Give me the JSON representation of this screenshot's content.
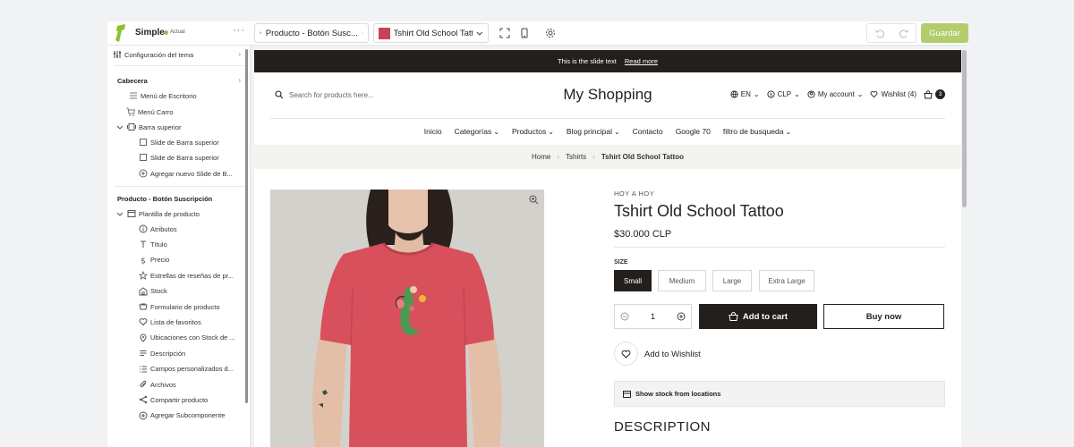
{
  "topbar": {
    "brand": "Simple",
    "status": "Actual",
    "more": "···",
    "template_select": "Producto - Botón Susc...",
    "product_select": "Tshirt Old School Tattc",
    "save_label": "Guardar"
  },
  "sidebar": {
    "theme_settings": "Configuración del tema",
    "header_section": "Cabecera",
    "desktop_menu": "Menú de Escritorio",
    "cart_menu": "Menú Carro",
    "top_bar": "Barra superior",
    "slide_1": "Slide de Barra superior",
    "slide_2": "Slide de Barra superior",
    "add_slide": "Agregar nuevo Slide de B...",
    "product_section": "Producto - Botón Suscripción",
    "product_template": "Plantilla de producto",
    "items": [
      {
        "label": "Atributos",
        "icon": "info-icon"
      },
      {
        "label": "Título",
        "icon": "text-icon"
      },
      {
        "label": "Precio",
        "icon": "dollar-icon"
      },
      {
        "label": "Estrellas de reseñas de pr...",
        "icon": "star-review-icon"
      },
      {
        "label": "Stock",
        "icon": "warehouse-icon"
      },
      {
        "label": "Formulario de producto",
        "icon": "cart-form-icon"
      },
      {
        "label": "Lista de favoritos",
        "icon": "heart-icon"
      },
      {
        "label": "Ubicaciones con Stock de ...",
        "icon": "location-icon"
      },
      {
        "label": "Descripción",
        "icon": "description-icon"
      },
      {
        "label": "Campos personalizados d...",
        "icon": "list-icon"
      },
      {
        "label": "Archivos",
        "icon": "attachment-icon"
      },
      {
        "label": "Compartir producto",
        "icon": "share-icon"
      },
      {
        "label": "Agregar Subcomponente",
        "icon": "plus-circle-icon"
      }
    ]
  },
  "preview": {
    "announcement": "This is the slide text",
    "announcement_link": "Read more",
    "search_placeholder": "Search for products here...",
    "shop_title": "My Shopping",
    "lang": "EN",
    "currency": "CLP",
    "account": "My account",
    "wishlist": "Wishlist (4)",
    "cart_count": "3",
    "nav": [
      "Inicio",
      "Categorías",
      "Productos",
      "Blog principal",
      "Contacto",
      "Google 70",
      "filtro de busqueda"
    ],
    "breadcrumb": {
      "home": "Home",
      "category": "Tshirts",
      "current": "Tshirt Old School Tattoo"
    },
    "product": {
      "vendor": "HOY A HOY",
      "title": "Tshirt Old School Tattoo",
      "price": "$30.000 CLP",
      "size_label": "SIZE",
      "sizes": [
        "Small",
        "Medium",
        "Large",
        "Extra Large"
      ],
      "quantity": "1",
      "add_to_cart": "Add to cart",
      "buy_now": "Buy now",
      "wishlist": "Add to Wishlist",
      "stock_locations": "Show stock from locations",
      "description_heading": "DESCRIPTION"
    }
  },
  "colors": {
    "accent_green": "#b3cd6c",
    "dark": "#231f1c",
    "shirt_red": "#d8505b"
  }
}
